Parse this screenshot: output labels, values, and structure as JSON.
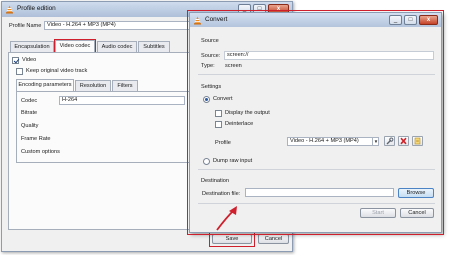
{
  "profile_window": {
    "title": "Profile edition",
    "title_buttons": [
      "_",
      "□",
      "x"
    ],
    "profile_name_label": "Profile Name",
    "profile_name_value": "Video - H.264 + MP3 (MP4)",
    "tabs": [
      {
        "label": "Encapsulation"
      },
      {
        "label": "Video codec"
      },
      {
        "label": "Audio codec"
      },
      {
        "label": "Subtitles"
      }
    ],
    "video_checkbox": "Video",
    "keep_original_checkbox": "Keep original video track",
    "subtabs": [
      {
        "label": "Encoding parameters"
      },
      {
        "label": "Resolution"
      },
      {
        "label": "Filters"
      }
    ],
    "fields": {
      "codec_label": "Codec",
      "codec_value": "H-264",
      "bitrate_label": "Bitrate",
      "quality_label": "Quality",
      "frame_rate_label": "Frame Rate",
      "custom_options_label": "Custom options"
    },
    "save_label": "Save",
    "cancel_label": "Cancel",
    "highlight_color": "#d01f2c"
  },
  "convert_window": {
    "title": "Convert",
    "title_buttons": [
      "_",
      "□",
      "x"
    ],
    "source": {
      "heading": "Source",
      "source_label": "Source:",
      "source_value": "screen://",
      "type_label": "Type:",
      "type_value": "screen"
    },
    "settings": {
      "heading": "Settings",
      "convert_radio": "Convert",
      "display_output": "Display the output",
      "deinterlace": "Deinterlace",
      "profile_label": "Profile",
      "profile_value": "Video - H.264 + MP3 (MP4)",
      "dump_raw": "Dump raw input"
    },
    "destination": {
      "heading": "Destination",
      "file_label": "Destination file:",
      "file_value": "",
      "browse_label": "Browse"
    },
    "start_label": "Start",
    "cancel_label": "Cancel",
    "highlight_color": "#d01f2c"
  },
  "icons": {
    "app_icon": "vlc-cone-icon",
    "edit_profile": "wrench-icon",
    "delete_profile": "red-x-icon",
    "new_profile": "new-profile-icon",
    "pointer": "red-arrow"
  }
}
